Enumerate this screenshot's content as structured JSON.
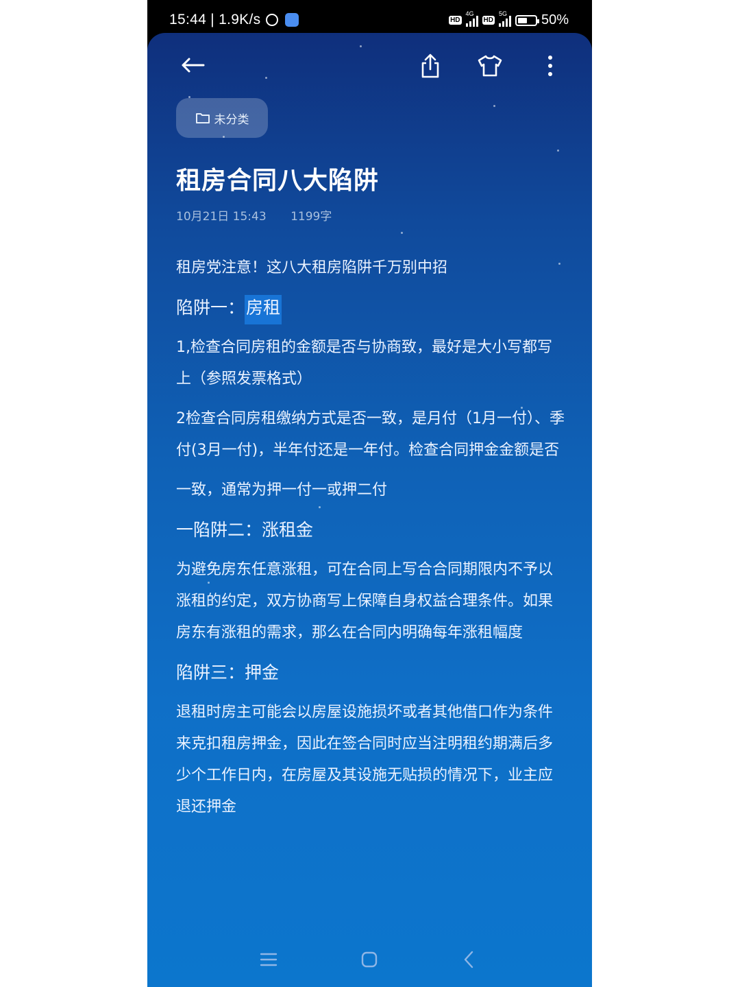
{
  "status_bar": {
    "time_speed": "15:44 | 1.9K/s",
    "net1": "4G",
    "net2": "5G",
    "hd": "HD",
    "battery": "50%"
  },
  "toolbar": {
    "back_icon": "arrow-left-icon",
    "share_icon": "share-icon",
    "theme_icon": "tshirt-icon",
    "more_icon": "more-vertical-icon"
  },
  "note": {
    "category": "未分类",
    "title": "租房合同八大陷阱",
    "date": "10月21日  15:43",
    "word_count": "1199字",
    "lines": {
      "l1": "租房党注意！这八大租房陷阱千万别中招",
      "h1_prefix": "陷阱一：",
      "h1_highlight": "房租",
      "p1": "1,检查合同房租的金额是否与协商致，最好是大小写都写上（参照发票格式）",
      "p2": "2检查合同房租缴纳方式是否一致，是月付（1月一付）、季付(3月一付)，半年付还是一年付。检查合同押金金额是否",
      "p3": "一致，通常为押一付一或押二付",
      "h2": "一陷阱二：涨租金",
      "p4": "为避免房东任意涨租，可在合同上写合合同期限内不予以涨租的约定，双方协商写上保障自身权益合理条件。如果房东有涨租的需求，那么在合同内明确每年涨租幅度",
      "h3": "陷阱三：押金",
      "p5": "退租时房主可能会以房屋设施损坏或者其他借口作为条件来克扣租房押金，因此在签合同时应当注明租约期满后多少个工作日内，在房屋及其设施无贴损的情况下，业主应退还押金"
    }
  },
  "navbar": {
    "menu_icon": "menu-icon",
    "home_icon": "home-square-icon",
    "back_icon": "back-chevron-icon"
  },
  "colors": {
    "bg_top": "#0f2f7c",
    "bg_bottom": "#0c76cd",
    "highlight": "#1874d6"
  }
}
